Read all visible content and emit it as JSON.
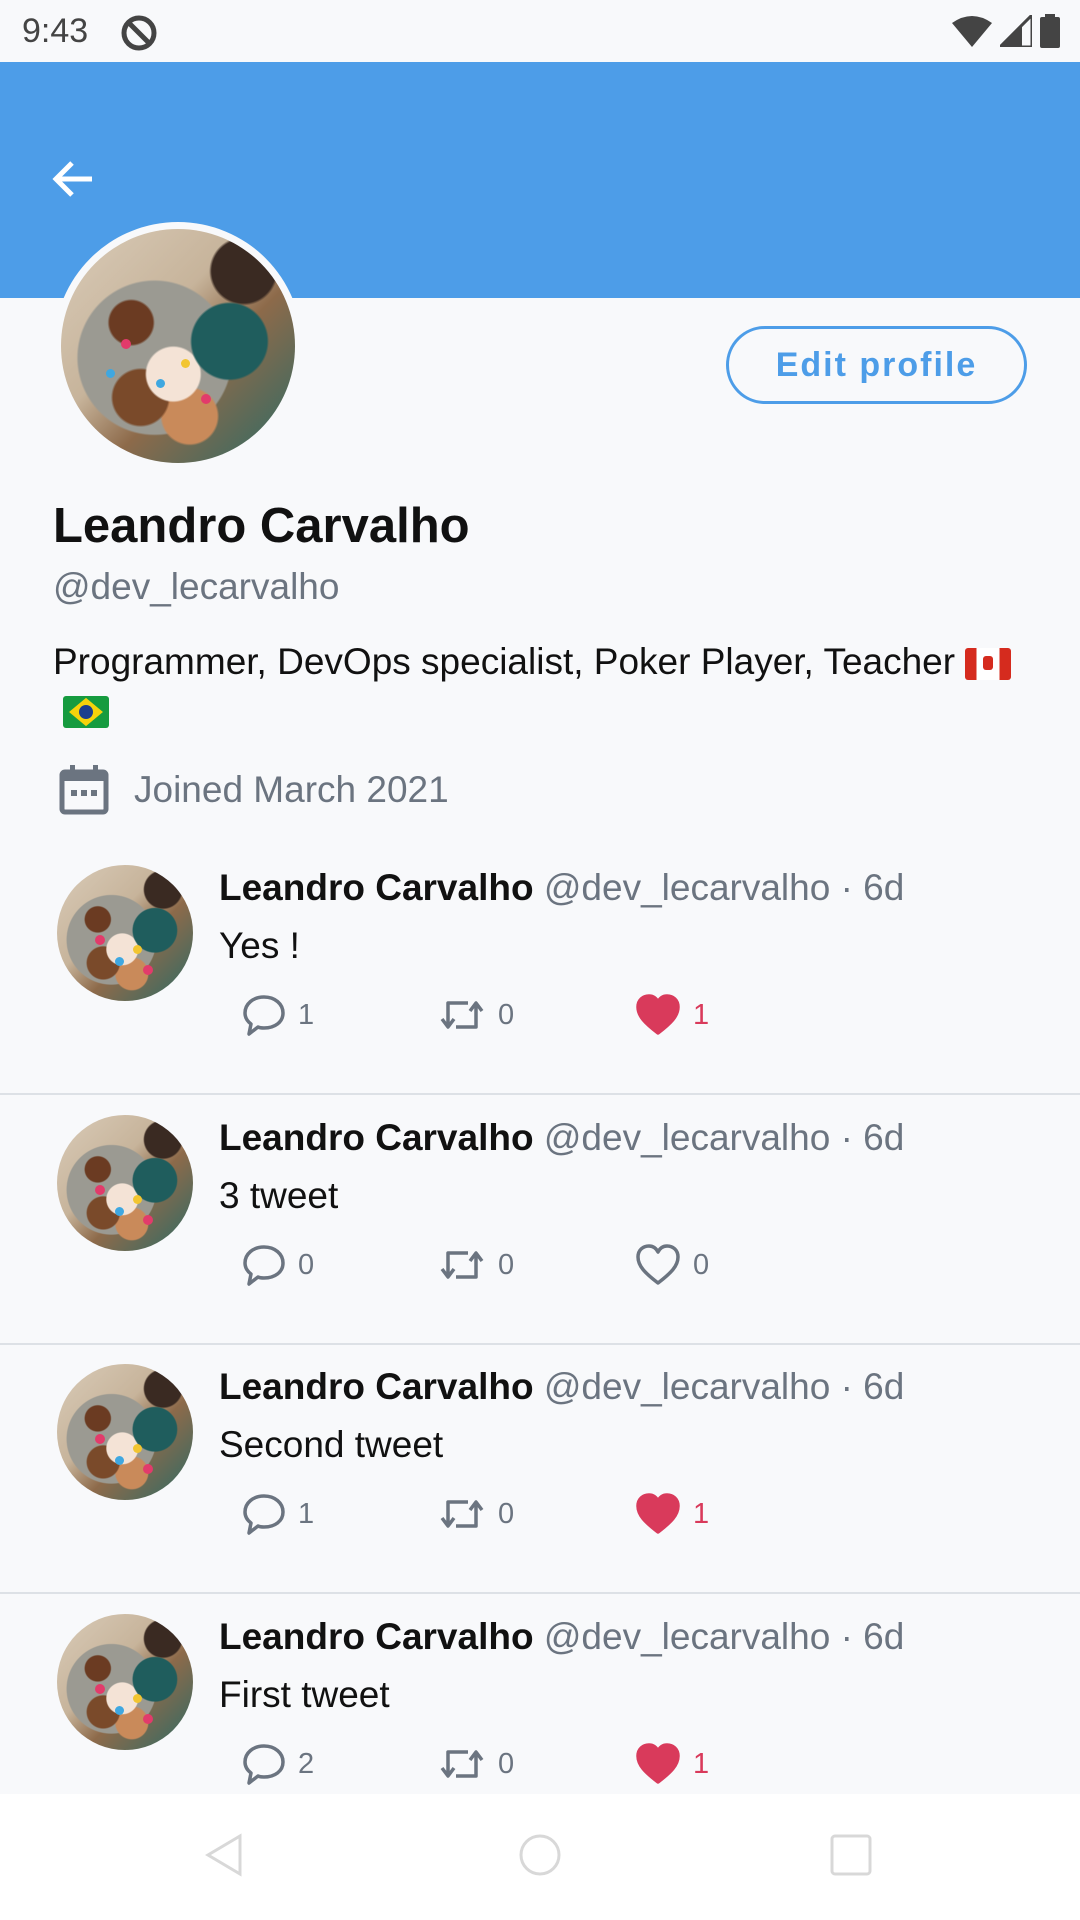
{
  "status_bar": {
    "time": "9:43",
    "icons": [
      "dnd-icon",
      "wifi-icon",
      "signal-icon",
      "battery-icon"
    ]
  },
  "header": {
    "banner_color": "#4d9de8",
    "back_icon": "arrow-left-icon"
  },
  "profile": {
    "edit_label": "Edit profile",
    "name": "Leandro Carvalho",
    "handle": "@dev_lecarvalho",
    "bio": "Programmer, DevOps specialist, Poker Player, Teacher",
    "bio_flags": [
      "flag-canada",
      "flag-brazil"
    ],
    "joined": "Joined March 2021",
    "joined_icon": "calendar-icon"
  },
  "tweets": [
    {
      "name": "Leandro Carvalho",
      "meta": "@dev_lecarvalho · 6d",
      "text": "Yes !",
      "replies": "1",
      "retweets": "0",
      "likes": "1",
      "liked": true
    },
    {
      "name": "Leandro Carvalho",
      "meta": "@dev_lecarvalho · 6d",
      "text": "3 tweet",
      "replies": "0",
      "retweets": "0",
      "likes": "0",
      "liked": false
    },
    {
      "name": "Leandro Carvalho",
      "meta": "@dev_lecarvalho · 6d",
      "text": "Second tweet",
      "replies": "1",
      "retweets": "0",
      "likes": "1",
      "liked": true
    },
    {
      "name": "Leandro Carvalho",
      "meta": "@dev_lecarvalho · 6d",
      "text": "First tweet",
      "replies": "2",
      "retweets": "0",
      "likes": "1",
      "liked": true
    }
  ],
  "colors": {
    "accent": "#4d9de8",
    "like": "#d93a5b",
    "muted": "#6b7480"
  },
  "nav_bar": {
    "icons": [
      "nav-back-icon",
      "nav-home-icon",
      "nav-recents-icon"
    ]
  }
}
